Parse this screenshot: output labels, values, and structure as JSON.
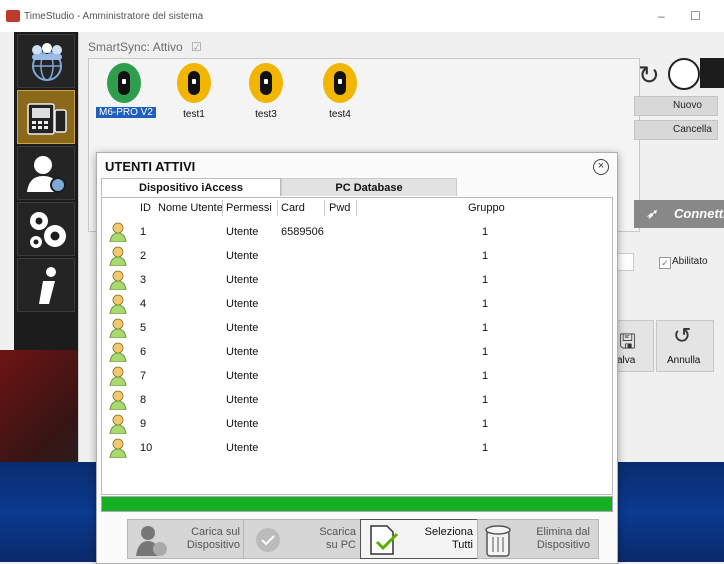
{
  "window": {
    "title": "TimeStudio - Amministratore del sistema",
    "minimize": "–",
    "maximize": "☐"
  },
  "smartsync": {
    "label": "SmartSync: Attivo",
    "check": "☑"
  },
  "devices": [
    {
      "name": "M6-PRO V2",
      "color": "#2e9d4e",
      "selected": true
    },
    {
      "name": "test1",
      "color": "#f2b500",
      "selected": false
    },
    {
      "name": "test3",
      "color": "#f2b500",
      "selected": false
    },
    {
      "name": "test4",
      "color": "#f2b500",
      "selected": false
    }
  ],
  "right_panel": {
    "nuovo": "Nuovo",
    "cancella": "Cancella",
    "connetti": "Connetti",
    "abilitato": "Abilitato",
    "salva": "alva",
    "annulla": "Annulla"
  },
  "modal": {
    "title": "UTENTI ATTIVI",
    "tabs": [
      "Dispositivo iAccess",
      "PC Database"
    ],
    "columns": [
      "ID",
      "Nome Utente",
      "Permessi",
      "Card",
      "Pwd",
      "Gruppo"
    ],
    "rows": [
      {
        "id": "1",
        "nome": "",
        "permessi": "Utente",
        "card": "6589506",
        "pwd": "",
        "gruppo": "1"
      },
      {
        "id": "2",
        "nome": "",
        "permessi": "Utente",
        "card": "",
        "pwd": "",
        "gruppo": "1"
      },
      {
        "id": "3",
        "nome": "",
        "permessi": "Utente",
        "card": "",
        "pwd": "",
        "gruppo": "1"
      },
      {
        "id": "4",
        "nome": "",
        "permessi": "Utente",
        "card": "",
        "pwd": "",
        "gruppo": "1"
      },
      {
        "id": "5",
        "nome": "",
        "permessi": "Utente",
        "card": "",
        "pwd": "",
        "gruppo": "1"
      },
      {
        "id": "6",
        "nome": "",
        "permessi": "Utente",
        "card": "",
        "pwd": "",
        "gruppo": "1"
      },
      {
        "id": "7",
        "nome": "",
        "permessi": "Utente",
        "card": "",
        "pwd": "",
        "gruppo": "1"
      },
      {
        "id": "8",
        "nome": "",
        "permessi": "Utente",
        "card": "",
        "pwd": "",
        "gruppo": "1"
      },
      {
        "id": "9",
        "nome": "",
        "permessi": "Utente",
        "card": "",
        "pwd": "",
        "gruppo": "1"
      },
      {
        "id": "10",
        "nome": "",
        "permessi": "Utente",
        "card": "",
        "pwd": "",
        "gruppo": "1"
      }
    ],
    "progress": 1.0,
    "buttons": {
      "carica": [
        "Carica sul",
        "Dispositivo"
      ],
      "scarica": [
        "Scarica",
        "su PC"
      ],
      "seleziona": [
        "Seleziona",
        "Tutti"
      ],
      "elimina": [
        "Elimina dal",
        "Dispositivo"
      ]
    }
  },
  "colors": {
    "progress": "#15b025",
    "selection": "#1f5fbf",
    "sidebar": "#1c1c1c"
  }
}
